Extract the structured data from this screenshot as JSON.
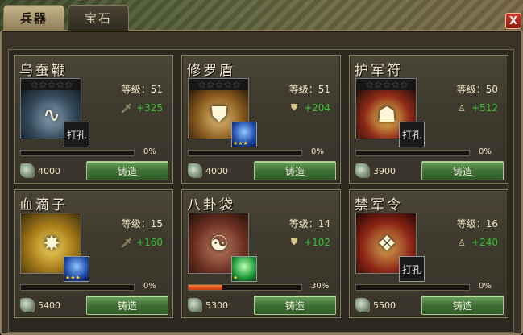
{
  "tabs": [
    {
      "label": "兵器",
      "active": true
    },
    {
      "label": "宝石",
      "active": false
    }
  ],
  "close_label": "X",
  "colors": {
    "stat_green": "#32c232",
    "forge_button": "#3f7036",
    "progress": "#e05a20"
  },
  "items": [
    {
      "name": "乌蚕鞭",
      "stars": "★★★★★",
      "level_label": "等级：51",
      "stat_icon": "sword-icon",
      "stat_glyph": "🗡",
      "stat": "+325",
      "socket": {
        "type": "empty",
        "label": "打孔"
      },
      "progress_fraction": 0.0,
      "progress_text": "0%",
      "cost": "4000",
      "forge_label": "铸造"
    },
    {
      "name": "修罗盾",
      "stars": "★★★★★",
      "level_label": "等级：51",
      "stat_icon": "shield-icon",
      "stat_glyph": "⛊",
      "stat": "+204",
      "socket": {
        "type": "gem-blue",
        "stars": "★★★"
      },
      "progress_fraction": 0.0,
      "progress_text": "0%",
      "cost": "4000",
      "forge_label": "铸造"
    },
    {
      "name": "护军符",
      "stars": "★★★★★",
      "level_label": "等级：50",
      "stat_icon": "person-icon",
      "stat_glyph": "♙",
      "stat": "+512",
      "socket": {
        "type": "empty",
        "label": "打孔"
      },
      "progress_fraction": 0.0,
      "progress_text": "0%",
      "cost": "3900",
      "forge_label": "铸造"
    },
    {
      "name": "血滴子",
      "stars": "",
      "level_label": "等级：15",
      "stat_icon": "sword-icon",
      "stat_glyph": "🗡",
      "stat": "+160",
      "socket": {
        "type": "gem-blue",
        "stars": "★★★"
      },
      "progress_fraction": 0.0,
      "progress_text": "0%",
      "cost": "5400",
      "forge_label": "铸造"
    },
    {
      "name": "八卦袋",
      "stars": "",
      "level_label": "等级：14",
      "stat_icon": "shield-icon",
      "stat_glyph": "⛊",
      "stat": "+102",
      "socket": {
        "type": "gem-green",
        "stars": "★"
      },
      "progress_fraction": 0.3,
      "progress_text": "30%",
      "cost": "5300",
      "forge_label": "铸造"
    },
    {
      "name": "禁军令",
      "stars": "",
      "level_label": "等级：16",
      "stat_icon": "person-icon",
      "stat_glyph": "♙",
      "stat": "+240",
      "socket": {
        "type": "empty",
        "label": "打孔"
      },
      "progress_fraction": 0.0,
      "progress_text": "0%",
      "cost": "5500",
      "forge_label": "铸造"
    }
  ]
}
